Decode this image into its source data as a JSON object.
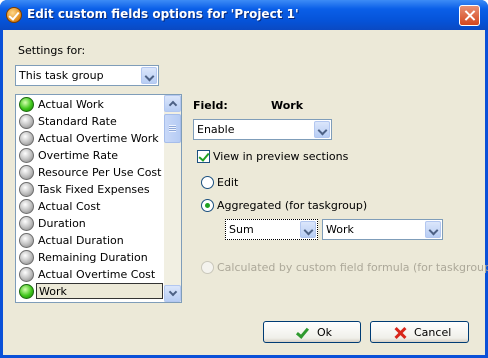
{
  "window": {
    "title": "Edit custom fields options for  'Project 1'"
  },
  "settings": {
    "label": "Settings for:",
    "selected": "This task group"
  },
  "fields_list": {
    "items": [
      {
        "label": "Actual Work",
        "status": "on"
      },
      {
        "label": "Standard Rate",
        "status": "off"
      },
      {
        "label": "Actual Overtime Work",
        "status": "off"
      },
      {
        "label": "Overtime Rate",
        "status": "off"
      },
      {
        "label": "Resource Per Use Cost",
        "status": "off"
      },
      {
        "label": "Task Fixed Expenses",
        "status": "off"
      },
      {
        "label": "Actual Cost",
        "status": "off"
      },
      {
        "label": "Duration",
        "status": "off"
      },
      {
        "label": "Actual Duration",
        "status": "off"
      },
      {
        "label": "Remaining Duration",
        "status": "off"
      },
      {
        "label": "Actual Overtime Cost",
        "status": "off"
      },
      {
        "label": "Work",
        "status": "on"
      }
    ],
    "selected": "Work"
  },
  "field_panel": {
    "field_label": "Field:",
    "field_name": "Work",
    "mode_selected": "Enable",
    "view_in_preview_label": "View in preview sections",
    "view_in_preview_checked": true,
    "edit_label": "Edit",
    "aggregated_label": "Aggregated (for taskgroup)",
    "aggregation_function": "Sum",
    "aggregation_field": "Work",
    "calculated_label": "Calculated by custom field formula (for taskgroup)"
  },
  "buttons": {
    "ok": "Ok",
    "cancel": "Cancel"
  },
  "colors": {
    "titlebar": "#0a5fe8",
    "dialog_bg": "#ece9d8",
    "status_on": "#3fc61b",
    "status_off": "#bdbdbd"
  }
}
